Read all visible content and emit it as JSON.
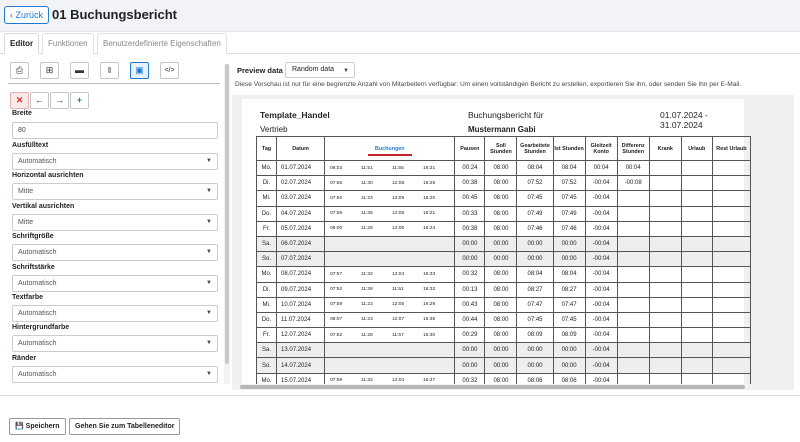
{
  "header": {
    "back_label": "Zurück",
    "title": "01 Buchungsbericht"
  },
  "tabs": [
    {
      "label": "Editor"
    },
    {
      "label": "Funktionen"
    },
    {
      "label": "Benutzerdefinierte Eigenschaften"
    }
  ],
  "toolbar_icons": [
    "print-icon",
    "table-icon",
    "row-icon",
    "column-icon",
    "cell-icon",
    "code-icon"
  ],
  "properties": {
    "breite": {
      "label": "Breite",
      "value": "80"
    },
    "ausfuelltext": {
      "label": "Ausfülltext",
      "value": "Automatisch"
    },
    "horizontal": {
      "label": "Horizontal ausrichten",
      "value": "Mitte"
    },
    "vertikal": {
      "label": "Vertikal ausrichten",
      "value": "Mitte"
    },
    "schriftgroesse": {
      "label": "Schriftgröße",
      "value": "Automatisch"
    },
    "schriftstaerke": {
      "label": "Schriftstärke",
      "value": "Automatisch"
    },
    "textfarbe": {
      "label": "Textfarbe",
      "value": "Automatisch"
    },
    "hintergrundfarbe": {
      "label": "Hintergrundfarbe",
      "value": "Automatisch"
    },
    "raender": {
      "label": "Ränder",
      "value": "Automatisch"
    }
  },
  "preview": {
    "label": "Preview data",
    "select_value": "Random data",
    "notice": "Diese Vorschau ist nur für eine begrenzte Anzahl von Mitarbeitern verfügbar: Um einen vollständigen Bericht zu erstellen, exportieren Sie ihn, oder senden Sie ihn per E-Mail."
  },
  "report": {
    "template": "Template_Handel",
    "subtitle": "Buchungsbericht für",
    "period": "01.07.2024 - 31.07.2024",
    "department": "Vertrieb",
    "employee": "Mustermann Gabi",
    "columns": [
      "Tag",
      "Datum",
      "Buchungen",
      "Pausen",
      "Soll Stunden",
      "Gearbeitete Stunden",
      "Ist Stunden",
      "Gleitzeit Konto",
      "Differenz Stunden",
      "Krank",
      "Urlaub",
      "Rest Urlaub"
    ],
    "rows": [
      {
        "tag": "Mo.",
        "datum": "01.07.2024",
        "b": [
          "08:03",
          "11:51",
          "11:55",
          "16:31"
        ],
        "pausen": "00:24",
        "soll": "08:00",
        "gearb": "08:04",
        "ist": "08:04",
        "gleit": "00:04",
        "diff": "00:04",
        "we": false
      },
      {
        "tag": "Di.",
        "datum": "02.07.2024",
        "b": [
          "07:55",
          "11:30",
          "12:08",
          "16:25"
        ],
        "pausen": "00:38",
        "soll": "08:00",
        "gearb": "07:52",
        "ist": "07:52",
        "gleit": "-00:04",
        "diff": "-00:08",
        "we": false
      },
      {
        "tag": "Mi.",
        "datum": "03.07.2024",
        "b": [
          "07:50",
          "11:24",
          "12:09",
          "16:20"
        ],
        "pausen": "00:45",
        "soll": "08:00",
        "gearb": "07:45",
        "ist": "07:45",
        "gleit": "-00:04",
        "diff": "",
        "we": false
      },
      {
        "tag": "Do.",
        "datum": "04.07.2024",
        "b": [
          "07:59",
          "11:35",
          "12:08",
          "16:21"
        ],
        "pausen": "00:33",
        "soll": "08:00",
        "gearb": "07:49",
        "ist": "07:49",
        "gleit": "-00:04",
        "diff": "",
        "we": false
      },
      {
        "tag": "Fr.",
        "datum": "05.07.2024",
        "b": [
          "08:00",
          "11:28",
          "12:06",
          "16:24"
        ],
        "pausen": "00:38",
        "soll": "08:00",
        "gearb": "07:46",
        "ist": "07:46",
        "gleit": "-00:04",
        "diff": "",
        "we": false
      },
      {
        "tag": "Sa.",
        "datum": "06.07.2024",
        "b": [],
        "pausen": "00:00",
        "soll": "00:00",
        "gearb": "00:00",
        "ist": "00:00",
        "gleit": "-00:04",
        "diff": "",
        "we": true
      },
      {
        "tag": "So.",
        "datum": "07.07.2024",
        "b": [],
        "pausen": "00:00",
        "soll": "00:00",
        "gearb": "00:00",
        "ist": "00:00",
        "gleit": "-00:04",
        "diff": "",
        "we": true
      },
      {
        "tag": "Mo.",
        "datum": "08.07.2024",
        "b": [
          "07:57",
          "11:32",
          "12:04",
          "16:33"
        ],
        "pausen": "00:32",
        "soll": "08:00",
        "gearb": "08:04",
        "ist": "08:04",
        "gleit": "-00:04",
        "diff": "",
        "we": false
      },
      {
        "tag": "Di.",
        "datum": "09.07.2024",
        "b": [
          "07:52",
          "11:38",
          "11:51",
          "16:32"
        ],
        "pausen": "00:13",
        "soll": "08:00",
        "gearb": "08:27",
        "ist": "08:27",
        "gleit": "-00:04",
        "diff": "",
        "we": false
      },
      {
        "tag": "Mi.",
        "datum": "10.07.2024",
        "b": [
          "07:59",
          "11:22",
          "12:05",
          "16:29"
        ],
        "pausen": "00:43",
        "soll": "08:00",
        "gearb": "07:47",
        "ist": "07:47",
        "gleit": "-00:04",
        "diff": "",
        "we": false
      },
      {
        "tag": "Do.",
        "datum": "11.07.2024",
        "b": [
          "08:07",
          "11:23",
          "12:07",
          "16:36"
        ],
        "pausen": "00:44",
        "soll": "08:00",
        "gearb": "07:45",
        "ist": "07:45",
        "gleit": "-00:04",
        "diff": "",
        "we": false
      },
      {
        "tag": "Fr.",
        "datum": "12.07.2024",
        "b": [
          "07:52",
          "11:28",
          "11:57",
          "16:30"
        ],
        "pausen": "00:29",
        "soll": "08:00",
        "gearb": "08:09",
        "ist": "08:09",
        "gleit": "-00:04",
        "diff": "",
        "we": false
      },
      {
        "tag": "Sa.",
        "datum": "13.07.2024",
        "b": [],
        "pausen": "00:00",
        "soll": "00:00",
        "gearb": "00:00",
        "ist": "00:00",
        "gleit": "-00:04",
        "diff": "",
        "we": true
      },
      {
        "tag": "So.",
        "datum": "14.07.2024",
        "b": [],
        "pausen": "00:00",
        "soll": "00:00",
        "gearb": "00:00",
        "ist": "00:00",
        "gleit": "-00:04",
        "diff": "",
        "we": true
      },
      {
        "tag": "Mo.",
        "datum": "15.07.2024",
        "b": [
          "07:59",
          "11:32",
          "12:04",
          "16:37"
        ],
        "pausen": "00:32",
        "soll": "08:00",
        "gearb": "08:06",
        "ist": "08:06",
        "gleit": "-00:04",
        "diff": "",
        "we": false
      }
    ]
  },
  "footer": {
    "save_label": "Speichern",
    "table_editor_label": "Gehen Sie zum Tabelleneditor"
  }
}
